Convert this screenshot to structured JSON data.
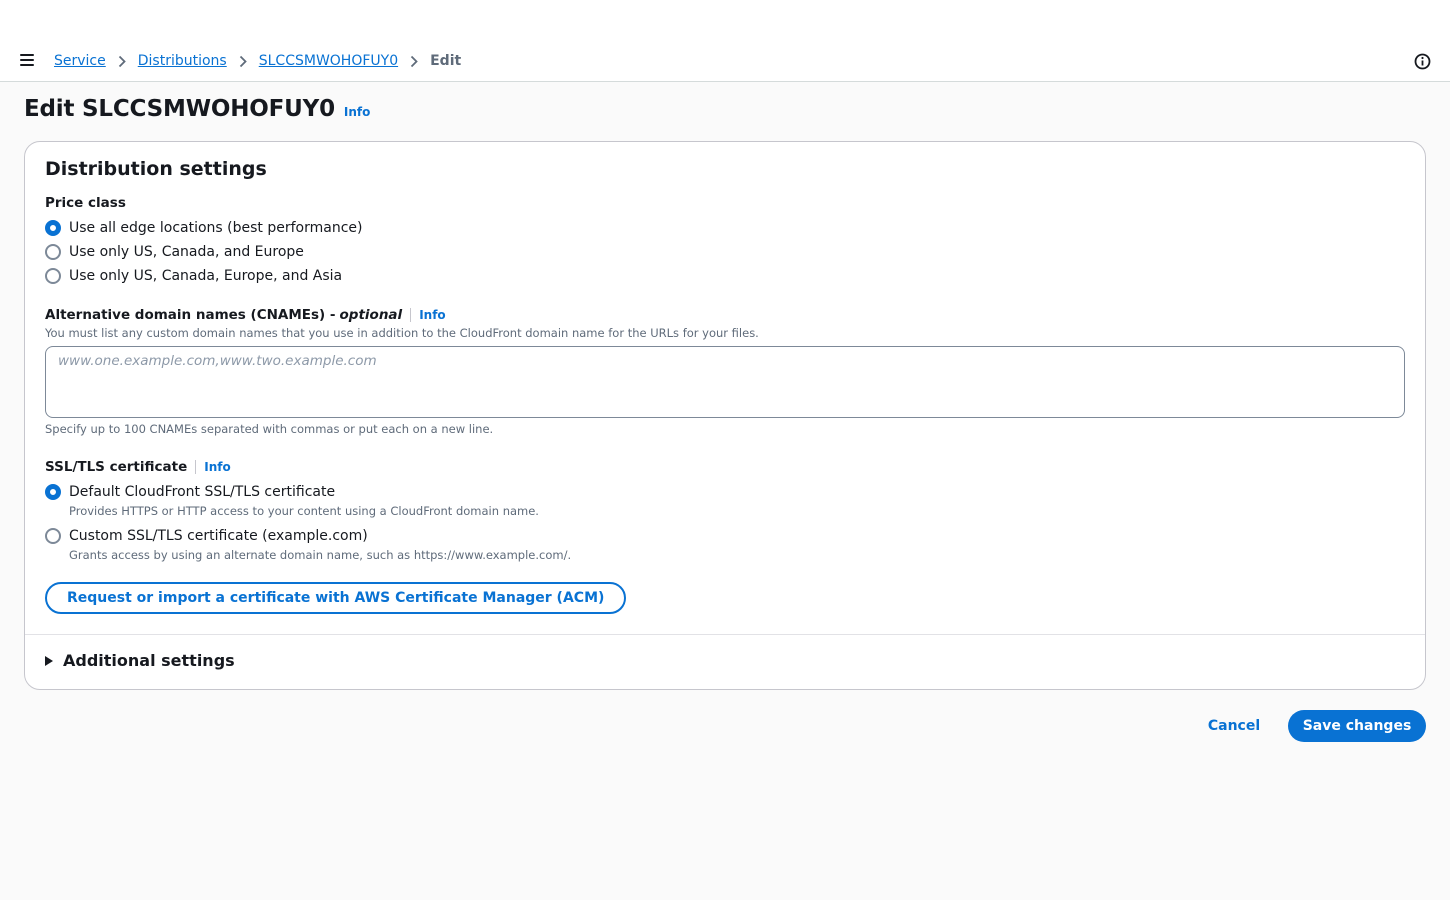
{
  "breadcrumb": {
    "items": [
      "Service",
      "Distributions",
      "SLCCSMWOHOFUY0"
    ],
    "current": "Edit"
  },
  "page": {
    "title": "Edit SLCCSMWOHOFUY0",
    "info": "Info"
  },
  "panel": {
    "title": "Distribution settings",
    "price_class": {
      "label": "Price class",
      "options": [
        "Use all edge locations (best performance)",
        "Use only US, Canada, and Europe",
        "Use only US, Canada, Europe, and Asia"
      ],
      "selected_index": 0
    },
    "cnames": {
      "label": "Alternative domain names (CNAMEs) -",
      "optional": "optional",
      "info": "Info",
      "description": "You must list any custom domain names that you use in addition to the CloudFront domain name for the URLs for your files.",
      "placeholder": "www.one.example.com,www.two.example.com",
      "value": "",
      "hint": "Specify up to 100 CNAMEs separated with commas or put each on a new line."
    },
    "ssl": {
      "label": "SSL/TLS certificate",
      "info": "Info",
      "options": [
        {
          "label": "Default CloudFront SSL/TLS certificate",
          "desc": "Provides HTTPS or HTTP access to your content using a CloudFront domain name."
        },
        {
          "label": "Custom SSL/TLS certificate (example.com)",
          "desc": "Grants access by using an alternate domain name, such as https://www.example.com/."
        }
      ],
      "selected_index": 0
    },
    "acm_button": "Request or import a certificate with AWS Certificate Manager (ACM)",
    "additional_settings": "Additional settings"
  },
  "footer": {
    "cancel": "Cancel",
    "save": "Save changes"
  },
  "colors": {
    "accent": "#0972d3",
    "text": "#16191f",
    "muted": "#5f6b7a"
  }
}
